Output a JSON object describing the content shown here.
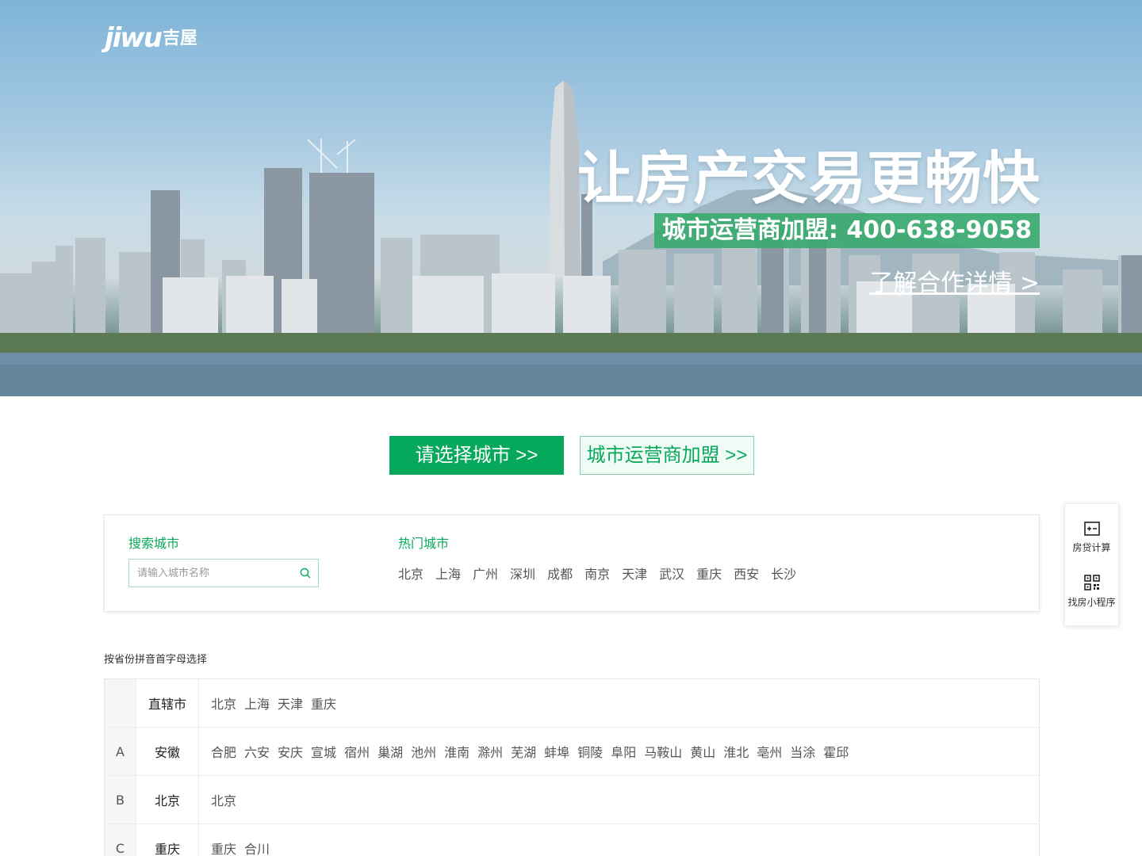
{
  "brand": {
    "logo_text": "jiwu",
    "logo_cn": "吉屋"
  },
  "hero": {
    "slogan": "让房产交易更畅快",
    "phone_badge": "城市运营商加盟: 400-638-9058",
    "learn_more": "了解合作详情 >"
  },
  "actions": {
    "select_city": "请选择城市 >>",
    "join_operator": "城市运营商加盟 >>"
  },
  "search": {
    "label": "搜索城市",
    "placeholder": "请输入城市名称",
    "hot_label": "热门城市",
    "hot_cities": [
      "北京",
      "上海",
      "广州",
      "深圳",
      "成都",
      "南京",
      "天津",
      "武汉",
      "重庆",
      "西安",
      "长沙"
    ]
  },
  "side_widget": {
    "mortgage_calc": "房贷计算",
    "mini_program": "找房小程序"
  },
  "provinces": {
    "title": "按省份拼音首字母选择",
    "rows": [
      {
        "letter": "",
        "province": "直辖市",
        "cities": [
          "北京",
          "上海",
          "天津",
          "重庆"
        ]
      },
      {
        "letter": "A",
        "province": "安徽",
        "cities": [
          "合肥",
          "六安",
          "安庆",
          "宣城",
          "宿州",
          "巢湖",
          "池州",
          "淮南",
          "滁州",
          "芜湖",
          "蚌埠",
          "铜陵",
          "阜阳",
          "马鞍山",
          "黄山",
          "淮北",
          "亳州",
          "当涂",
          "霍邱"
        ]
      },
      {
        "letter": "B",
        "province": "北京",
        "cities": [
          "北京"
        ]
      },
      {
        "letter": "C",
        "province": "重庆",
        "cities": [
          "重庆",
          "合川"
        ]
      }
    ]
  }
}
